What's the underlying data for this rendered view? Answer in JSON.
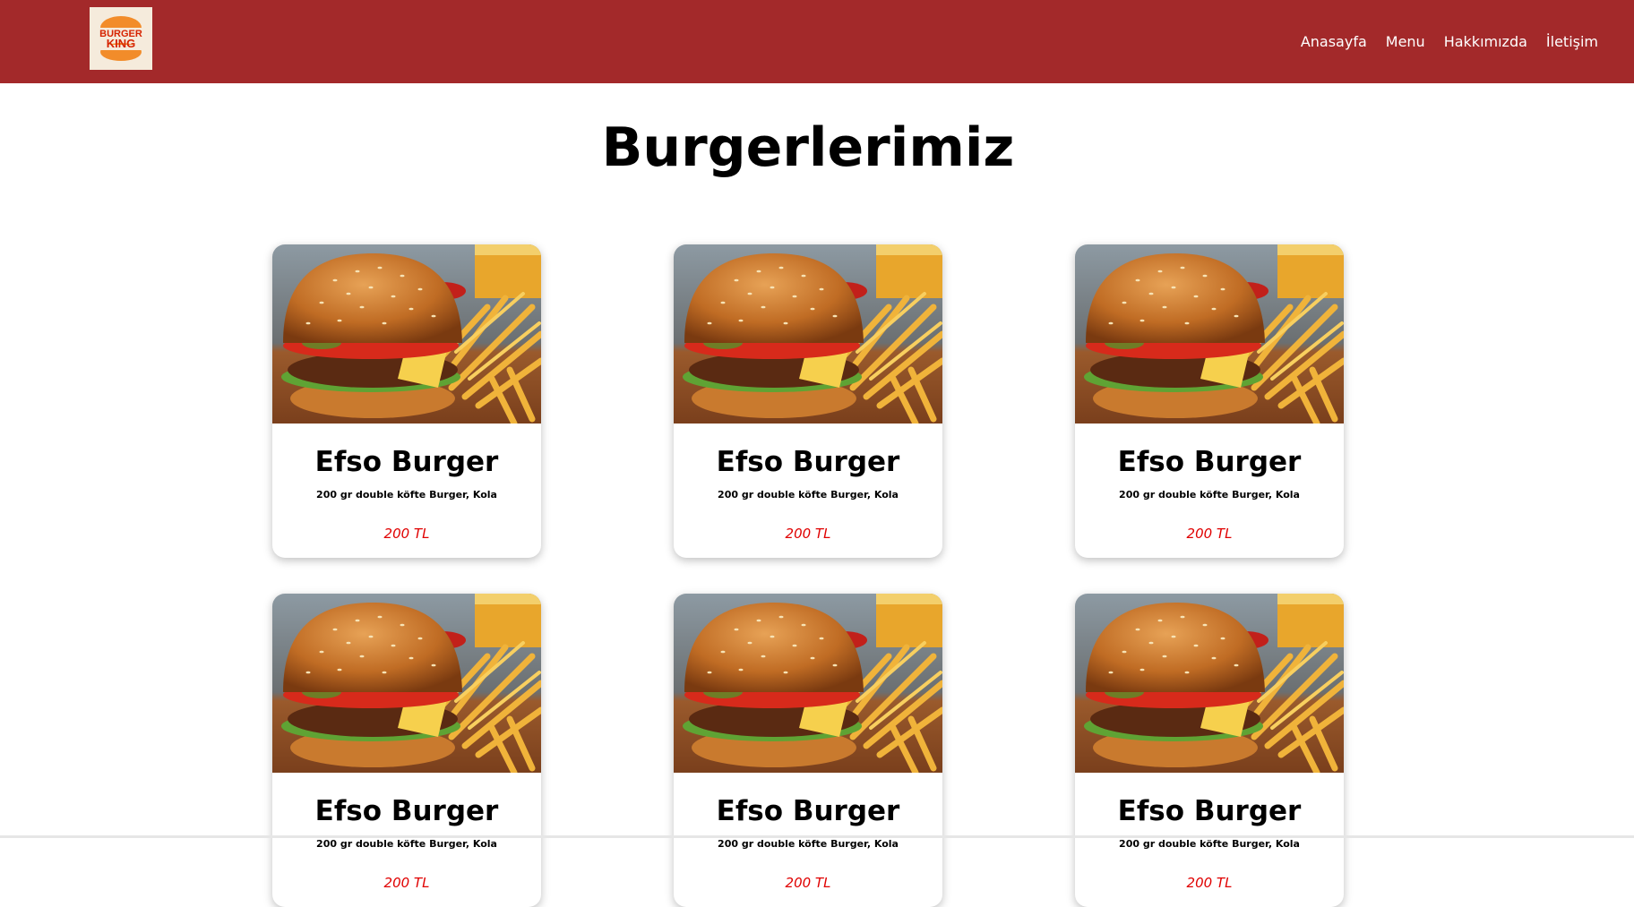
{
  "brand": {
    "logo_line1": "BURGER",
    "logo_line2": "KING",
    "colors": {
      "header": "#a3292a",
      "price": "#e00000",
      "logo_bun": "#f28c2a",
      "logo_text": "#d62300"
    }
  },
  "nav": {
    "items": [
      {
        "label": "Anasayfa"
      },
      {
        "label": "Menu"
      },
      {
        "label": "Hakkımızda"
      },
      {
        "label": "İletişim"
      }
    ]
  },
  "main": {
    "title": "Burgerlerimiz",
    "products": [
      {
        "name": "Efso Burger",
        "description": "200 gr double köfte Burger, Kola",
        "price": "200 TL",
        "image": "burger-fries-photo"
      },
      {
        "name": "Efso Burger",
        "description": "200 gr double köfte Burger, Kola",
        "price": "200 TL",
        "image": "burger-fries-photo"
      },
      {
        "name": "Efso Burger",
        "description": "200 gr double köfte Burger, Kola",
        "price": "200 TL",
        "image": "burger-fries-photo"
      },
      {
        "name": "Efso Burger",
        "description": "200 gr double köfte Burger, Kola",
        "price": "200 TL",
        "image": "burger-fries-photo"
      },
      {
        "name": "Efso Burger",
        "description": "200 gr double köfte Burger, Kola",
        "price": "200 TL",
        "image": "burger-fries-photo"
      },
      {
        "name": "Efso Burger",
        "description": "200 gr double köfte Burger, Kola",
        "price": "200 TL",
        "image": "burger-fries-photo"
      }
    ]
  }
}
